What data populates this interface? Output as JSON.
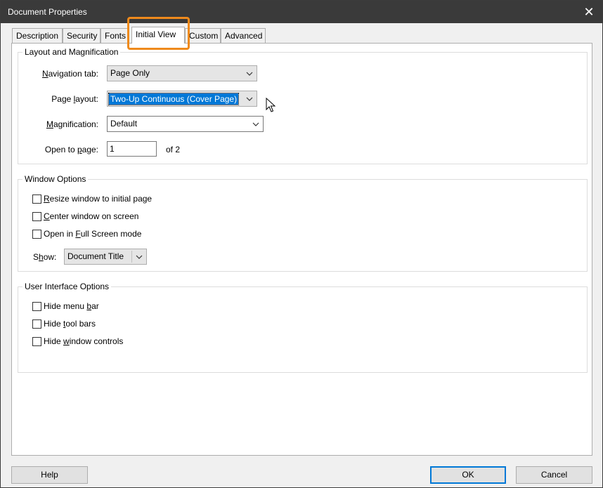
{
  "window": {
    "title": "Document Properties"
  },
  "tabs": [
    {
      "label": "Description"
    },
    {
      "label": "Security"
    },
    {
      "label": "Fonts"
    },
    {
      "label": "Initial View"
    },
    {
      "label": "Custom"
    },
    {
      "label": "Advanced"
    }
  ],
  "layout_group": {
    "label": "Layout and Magnification",
    "navigation_tab": {
      "label_pre": "",
      "label_key": "N",
      "label_post": "avigation tab:",
      "value": "Page Only"
    },
    "page_layout": {
      "label_pre": "Page ",
      "label_key": "l",
      "label_post": "ayout:",
      "value": "Two-Up Continuous (Cover Page)"
    },
    "magnification": {
      "label_pre": "",
      "label_key": "M",
      "label_post": "agnification:",
      "value": "Default"
    },
    "open_to_page": {
      "label_pre": "Open to ",
      "label_key": "p",
      "label_post": "age:",
      "value": "1",
      "of_text": "of 2"
    }
  },
  "window_group": {
    "label": "Window Options",
    "resize": {
      "pre": "",
      "key": "R",
      "post": "esize window to initial page"
    },
    "center": {
      "pre": "",
      "key": "C",
      "post": "enter window on screen"
    },
    "fullscreen": {
      "pre": "Open in ",
      "key": "F",
      "post": "ull Screen mode"
    },
    "show": {
      "label_pre": "S",
      "label_key": "h",
      "label_post": "ow:",
      "value": "Document Title"
    }
  },
  "ui_group": {
    "label": "User Interface Options",
    "hide_menu": {
      "pre": "Hide menu ",
      "key": "b",
      "post": "ar"
    },
    "hide_tool": {
      "pre": "Hide ",
      "key": "t",
      "post": "ool bars"
    },
    "hide_window": {
      "pre": "Hide ",
      "key": "w",
      "post": "indow controls"
    }
  },
  "buttons": {
    "help": "Help",
    "ok": "OK",
    "cancel": "Cancel"
  },
  "colors": {
    "titlebar": "#3a3a3a",
    "highlight": "#ef8a1c",
    "selection": "#0078d7"
  }
}
